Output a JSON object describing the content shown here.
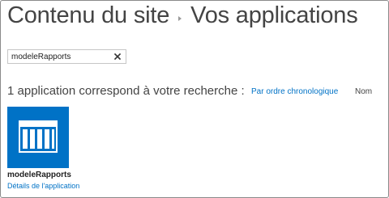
{
  "breadcrumb": {
    "parent": "Contenu du site",
    "current": "Vos applications"
  },
  "search": {
    "value": "modeleRapports",
    "clear_icon": "close-icon"
  },
  "results": {
    "summary": "1 application correspond à votre recherche :",
    "sort_chronological": "Par ordre chronologique",
    "sort_name": "Nom"
  },
  "apps": [
    {
      "name": "modeleRapports",
      "details_link": "Détails de l'application",
      "icon": "list-app-icon",
      "tile_color": "#0072c6"
    }
  ],
  "colors": {
    "accent": "#0072c6",
    "text": "#444444"
  }
}
